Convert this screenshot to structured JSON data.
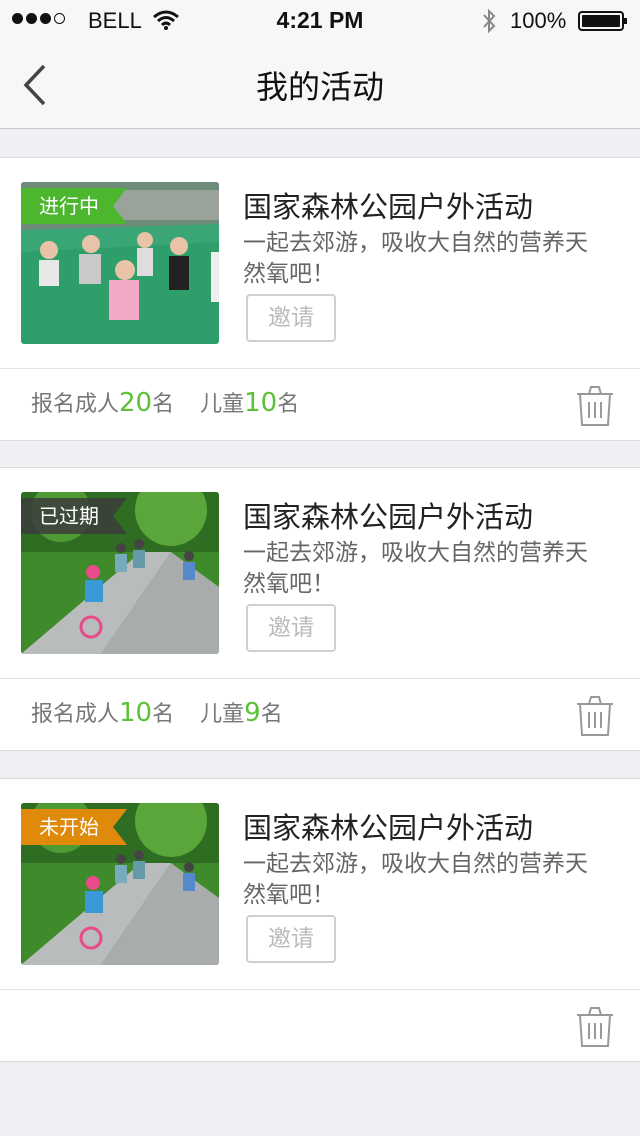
{
  "status_bar": {
    "carrier": "BELL",
    "time": "4:21 PM",
    "battery": "100%"
  },
  "nav": {
    "title": "我的活动"
  },
  "activities": [
    {
      "badge": "进行中",
      "badge_color": "#4cb62f",
      "title": "国家森林公园户外活动",
      "desc": "一起去郊游，吸收大自然的营养天然氧吧！",
      "invite_label": "邀请",
      "adult_label": "报名成人",
      "adult_count": "20",
      "unit": "名",
      "child_label": "儿童",
      "child_count": "10"
    },
    {
      "badge": "已过期",
      "badge_color": "#555555",
      "title": "国家森林公园户外活动",
      "desc": "一起去郊游，吸收大自然的营养天然氧吧！",
      "invite_label": "邀请",
      "adult_label": "报名成人",
      "adult_count": "10",
      "unit": "名",
      "child_label": "儿童",
      "child_count": "9"
    },
    {
      "badge": "未开始",
      "badge_color": "#e08a0c",
      "title": "国家森林公园户外活动",
      "desc": "一起去郊游，吸收大自然的营养天然氧吧！",
      "invite_label": "邀请"
    }
  ],
  "colors": {
    "accent_green": "#5bc238",
    "background": "#efeff4"
  },
  "icons": [
    "signal-icon",
    "wifi-icon",
    "bluetooth-icon",
    "battery-icon",
    "back-chevron-icon",
    "trash-icon"
  ]
}
